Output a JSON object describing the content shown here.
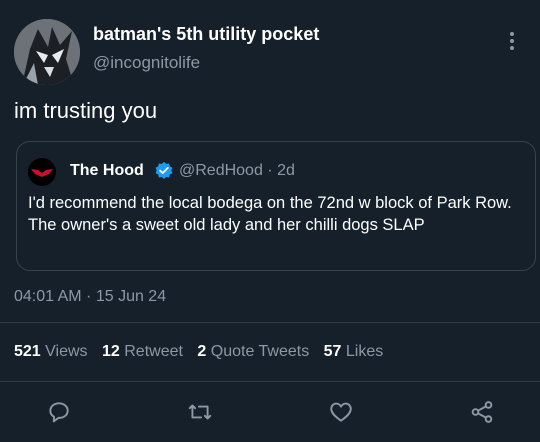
{
  "user": {
    "display_name": "batman's 5th utility pocket",
    "handle": "@incognitolife"
  },
  "tweet": {
    "text": "im trusting you",
    "timestamp": "04:01 AM · 15 Jun 24"
  },
  "quote": {
    "name": "The Hood",
    "handle": "@RedHood · 2d",
    "text": "I'd recommend the local bodega on the 72nd w block of Park Row. The owner's a sweet old lady and her chilli dogs SLAP"
  },
  "stats": {
    "views_count": "521",
    "views_label": "Views",
    "retweets_count": "12",
    "retweets_label": "Retweet",
    "quotes_count": "2",
    "quotes_label": "Quote Tweets",
    "likes_count": "57",
    "likes_label": "Likes"
  },
  "icons": {
    "more": "more-vertical-icon",
    "verified": "verified-badge-icon",
    "reply": "reply-icon",
    "retweet": "retweet-icon",
    "like": "heart-icon",
    "share": "share-icon"
  },
  "colors": {
    "background": "#15202b",
    "secondary_text": "#8b98a5",
    "verified_blue": "#1d9bf0",
    "border": "#38444d",
    "red_hood_logo": "#c8102e"
  }
}
